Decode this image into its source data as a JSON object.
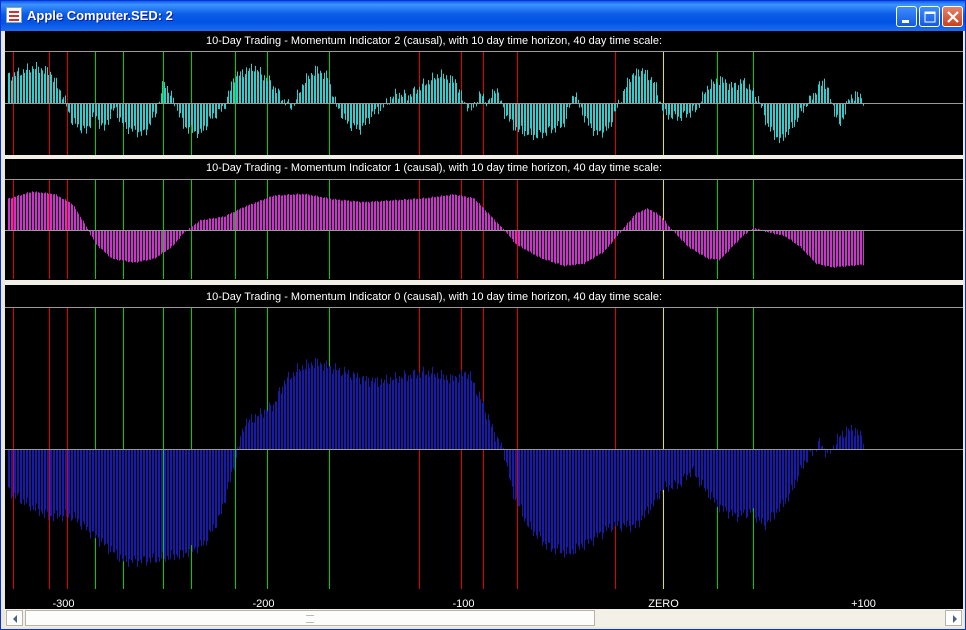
{
  "window": {
    "title": "Apple Computer.SED: 2",
    "buttons": {
      "minimize": "minimize",
      "maximize": "maximize",
      "close": "close"
    }
  },
  "colors": {
    "background": "#000000",
    "panel_separator": "#F2EFE6",
    "axis_line": "#9A9A9A",
    "red_marker": "#E00000",
    "green_marker": "#00D000",
    "zero_marker": "#E8E800",
    "indicator_2": "#33CCCC",
    "indicator_1": "#CC33CC",
    "indicator_0": "#1A1AAA"
  },
  "x_axis": {
    "ticks": [
      {
        "label": "-300",
        "value": -300
      },
      {
        "label": "-200",
        "value": -200
      },
      {
        "label": "-100",
        "value": -100
      },
      {
        "label": "ZERO",
        "value": 0
      },
      {
        "label": "+100",
        "value": 100
      }
    ],
    "range": [
      -328,
      146
    ]
  },
  "markers": {
    "red": [
      -325,
      -307,
      -298,
      -122,
      -101,
      -90,
      -73,
      -24
    ],
    "green": [
      -284,
      -270,
      -250,
      -236,
      -214,
      -198,
      -167,
      27,
      45
    ],
    "yellow": [
      0
    ]
  },
  "chart_data": [
    {
      "type": "bar",
      "title": "10-Day Trading - Momentum Indicator 2 (causal), with 10 day time horizon, 40 day time scale:",
      "x_range": [
        -328,
        100
      ],
      "key_points": [
        [
          -328,
          0.55
        ],
        [
          -315,
          0.75
        ],
        [
          -307,
          0.65
        ],
        [
          -300,
          0.1
        ],
        [
          -296,
          -0.4
        ],
        [
          -289,
          -0.6
        ],
        [
          -285,
          -0.25
        ],
        [
          -280,
          -0.55
        ],
        [
          -275,
          -0.1
        ],
        [
          -270,
          -0.5
        ],
        [
          -260,
          -0.65
        ],
        [
          -254,
          -0.2
        ],
        [
          -250,
          0.45
        ],
        [
          -244,
          -0.05
        ],
        [
          -240,
          -0.5
        ],
        [
          -232,
          -0.65
        ],
        [
          -226,
          -0.3
        ],
        [
          -220,
          -0.1
        ],
        [
          -215,
          0.55
        ],
        [
          -205,
          0.75
        ],
        [
          -197,
          0.45
        ],
        [
          -190,
          0.05
        ],
        [
          -186,
          -0.1
        ],
        [
          -180,
          0.45
        ],
        [
          -174,
          0.7
        ],
        [
          -168,
          0.55
        ],
        [
          -164,
          -0.05
        ],
        [
          -158,
          -0.45
        ],
        [
          -152,
          -0.55
        ],
        [
          -145,
          -0.2
        ],
        [
          -140,
          -0.05
        ],
        [
          -134,
          0.2
        ],
        [
          -128,
          0.15
        ],
        [
          -120,
          0.4
        ],
        [
          -112,
          0.6
        ],
        [
          -104,
          0.45
        ],
        [
          -100,
          0.0
        ],
        [
          -96,
          -0.15
        ],
        [
          -92,
          0.2
        ],
        [
          -88,
          0.0
        ],
        [
          -84,
          0.35
        ],
        [
          -80,
          -0.2
        ],
        [
          -74,
          -0.55
        ],
        [
          -64,
          -0.7
        ],
        [
          -56,
          -0.55
        ],
        [
          -50,
          -0.45
        ],
        [
          -45,
          0.25
        ],
        [
          -40,
          -0.3
        ],
        [
          -34,
          -0.65
        ],
        [
          -28,
          -0.55
        ],
        [
          -22,
          0.05
        ],
        [
          -17,
          0.55
        ],
        [
          -11,
          0.7
        ],
        [
          -5,
          0.45
        ],
        [
          0,
          -0.25
        ],
        [
          8,
          -0.3
        ],
        [
          16,
          -0.15
        ],
        [
          22,
          0.35
        ],
        [
          28,
          0.5
        ],
        [
          34,
          0.35
        ],
        [
          40,
          0.45
        ],
        [
          47,
          0.1
        ],
        [
          52,
          -0.5
        ],
        [
          58,
          -0.8
        ],
        [
          64,
          -0.5
        ],
        [
          70,
          -0.1
        ],
        [
          75,
          0.2
        ],
        [
          80,
          0.5
        ],
        [
          85,
          -0.15
        ],
        [
          88,
          -0.5
        ],
        [
          92,
          0.05
        ],
        [
          96,
          0.2
        ],
        [
          100,
          0.05
        ]
      ]
    },
    {
      "type": "bar",
      "title": "10-Day Trading - Momentum Indicator 1 (causal), with 10 day time horizon, 40 day time scale:",
      "x_range": [
        -328,
        100
      ],
      "key_points": [
        [
          -328,
          0.65
        ],
        [
          -316,
          0.8
        ],
        [
          -305,
          0.75
        ],
        [
          -296,
          0.55
        ],
        [
          -290,
          0.15
        ],
        [
          -284,
          -0.3
        ],
        [
          -276,
          -0.6
        ],
        [
          -265,
          -0.68
        ],
        [
          -255,
          -0.6
        ],
        [
          -246,
          -0.35
        ],
        [
          -240,
          -0.05
        ],
        [
          -232,
          0.2
        ],
        [
          -220,
          0.28
        ],
        [
          -210,
          0.48
        ],
        [
          -195,
          0.72
        ],
        [
          -180,
          0.75
        ],
        [
          -165,
          0.64
        ],
        [
          -150,
          0.58
        ],
        [
          -135,
          0.62
        ],
        [
          -120,
          0.66
        ],
        [
          -105,
          0.74
        ],
        [
          -95,
          0.66
        ],
        [
          -88,
          0.35
        ],
        [
          -80,
          0.0
        ],
        [
          -74,
          -0.3
        ],
        [
          -62,
          -0.58
        ],
        [
          -50,
          -0.75
        ],
        [
          -40,
          -0.7
        ],
        [
          -30,
          -0.45
        ],
        [
          -22,
          -0.05
        ],
        [
          -14,
          0.35
        ],
        [
          -8,
          0.45
        ],
        [
          -2,
          0.3
        ],
        [
          4,
          0.0
        ],
        [
          12,
          -0.35
        ],
        [
          22,
          -0.6
        ],
        [
          28,
          -0.62
        ],
        [
          34,
          -0.35
        ],
        [
          40,
          -0.1
        ],
        [
          45,
          0.05
        ],
        [
          52,
          -0.05
        ],
        [
          60,
          -0.12
        ],
        [
          68,
          -0.35
        ],
        [
          76,
          -0.7
        ],
        [
          84,
          -0.78
        ],
        [
          92,
          -0.75
        ],
        [
          100,
          -0.72
        ]
      ]
    },
    {
      "type": "bar",
      "title": "10-Day Trading - Momentum Indicator 0 (causal), with 10 day time horizon, 40 day time scale:",
      "x_range": [
        -328,
        100
      ],
      "key_points": [
        [
          -328,
          -0.3
        ],
        [
          -318,
          -0.4
        ],
        [
          -308,
          -0.48
        ],
        [
          -296,
          -0.48
        ],
        [
          -288,
          -0.58
        ],
        [
          -280,
          -0.68
        ],
        [
          -270,
          -0.8
        ],
        [
          -262,
          -0.8
        ],
        [
          -250,
          -0.78
        ],
        [
          -240,
          -0.75
        ],
        [
          -230,
          -0.68
        ],
        [
          -222,
          -0.48
        ],
        [
          -215,
          -0.12
        ],
        [
          -210,
          0.18
        ],
        [
          -202,
          0.25
        ],
        [
          -195,
          0.32
        ],
        [
          -190,
          0.48
        ],
        [
          -182,
          0.58
        ],
        [
          -174,
          0.62
        ],
        [
          -160,
          0.55
        ],
        [
          -150,
          0.5
        ],
        [
          -142,
          0.48
        ],
        [
          -130,
          0.52
        ],
        [
          -118,
          0.55
        ],
        [
          -106,
          0.5
        ],
        [
          -98,
          0.55
        ],
        [
          -90,
          0.3
        ],
        [
          -86,
          0.15
        ],
        [
          -80,
          -0.02
        ],
        [
          -76,
          -0.3
        ],
        [
          -68,
          -0.55
        ],
        [
          -58,
          -0.7
        ],
        [
          -48,
          -0.75
        ],
        [
          -36,
          -0.65
        ],
        [
          -26,
          -0.55
        ],
        [
          -14,
          -0.55
        ],
        [
          -6,
          -0.4
        ],
        [
          0,
          -0.28
        ],
        [
          8,
          -0.25
        ],
        [
          14,
          -0.15
        ],
        [
          20,
          -0.28
        ],
        [
          28,
          -0.42
        ],
        [
          36,
          -0.48
        ],
        [
          44,
          -0.45
        ],
        [
          50,
          -0.55
        ],
        [
          56,
          -0.45
        ],
        [
          62,
          -0.35
        ],
        [
          70,
          -0.1
        ],
        [
          78,
          0.05
        ],
        [
          82,
          -0.05
        ],
        [
          88,
          0.1
        ],
        [
          94,
          0.15
        ],
        [
          100,
          0.08
        ]
      ]
    }
  ]
}
